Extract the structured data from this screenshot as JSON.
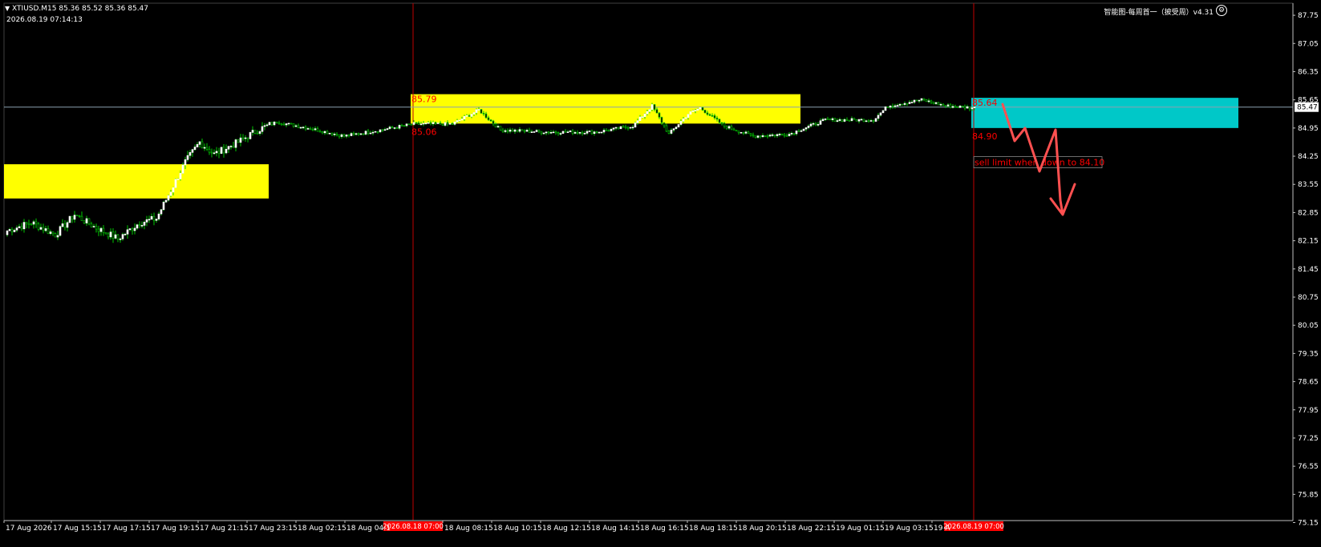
{
  "header": {
    "menu_icon": "triangle-down-icon",
    "symbol_line": "XTIUSD.M15  85.36 85.52 85.36 85.47",
    "timestamp": "2026.08.19 07:14:13",
    "indicator_label": "智能图-每周首一（披受周）v4.31",
    "settings_icon": "gear-circle-icon"
  },
  "colors": {
    "background": "#000000",
    "bull_candle": "#ffffff",
    "bear_candle": "#00c800",
    "wick": "#00c800",
    "zone_yellow": "#ffff00",
    "zone_cyan": "#00c8c8",
    "vline": "#c00000",
    "bid_line": "#8aa0b0",
    "label_red": "#ff0000",
    "arrow": "#ff5050"
  },
  "chart_data": {
    "type": "candlestick",
    "symbol": "XTIUSD",
    "timeframe": "M15",
    "ylim": [
      75.2,
      88.05
    ],
    "price_axis_ticks": [
      "87.75",
      "87.05",
      "86.35",
      "85.65",
      "84.95",
      "84.25",
      "83.55",
      "82.85",
      "82.15",
      "81.45",
      "80.75",
      "80.05",
      "79.35",
      "78.65",
      "77.95",
      "77.25",
      "76.55",
      "75.85",
      "75.15"
    ],
    "current_price": "85.47",
    "time_axis_labels": [
      "17 Aug 2026",
      "17 Aug 15:15",
      "17 Aug 17:15",
      "17 Aug 19:15",
      "17 Aug 21:15",
      "17 Aug 23:15",
      "18 Aug 02:15",
      "18 Aug 04:1",
      "18 Aug 08:15",
      "18 Aug 10:15",
      "18 Aug 12:15",
      "18 Aug 14:15",
      "18 Aug 16:15",
      "18 Aug 18:15",
      "18 Aug 20:15",
      "18 Aug 22:15",
      "19 Aug 01:15",
      "19 Aug 03:15",
      "19 A"
    ],
    "vertical_markers": [
      {
        "label": "2026.08.18 07:00",
        "bar": 169
      },
      {
        "label": "2026.08.19 07:00",
        "bar": 402
      }
    ],
    "zones": [
      {
        "color": "yellow",
        "bar_start": 0,
        "bar_end": 109,
        "high": 84.05,
        "low": 83.2
      },
      {
        "color": "yellow",
        "bar_start": 169,
        "bar_end": 330,
        "high": 85.79,
        "low": 85.06,
        "high_label": "85.79",
        "low_label": "85.06"
      },
      {
        "color": "cyan",
        "bar_start": 402,
        "bar_end": 512,
        "high": 85.7,
        "low": 84.95,
        "high_label": "85.64",
        "low_label": "84.90"
      }
    ],
    "annotation": "sell limit when down to 84.10",
    "anchors": [
      {
        "bar": 0,
        "price": 82.4
      },
      {
        "bar": 10,
        "price": 82.6
      },
      {
        "bar": 20,
        "price": 82.3
      },
      {
        "bar": 28,
        "price": 82.8
      },
      {
        "bar": 36,
        "price": 82.5
      },
      {
        "bar": 46,
        "price": 82.2
      },
      {
        "bar": 55,
        "price": 82.6
      },
      {
        "bar": 62,
        "price": 82.7
      },
      {
        "bar": 68,
        "price": 83.4
      },
      {
        "bar": 74,
        "price": 84.1
      },
      {
        "bar": 80,
        "price": 84.6
      },
      {
        "bar": 86,
        "price": 84.3
      },
      {
        "bar": 96,
        "price": 84.6
      },
      {
        "bar": 104,
        "price": 84.9
      },
      {
        "bar": 112,
        "price": 85.1
      },
      {
        "bar": 125,
        "price": 84.95
      },
      {
        "bar": 140,
        "price": 84.75
      },
      {
        "bar": 155,
        "price": 84.9
      },
      {
        "bar": 169,
        "price": 85.05
      },
      {
        "bar": 185,
        "price": 85.05
      },
      {
        "bar": 196,
        "price": 85.4
      },
      {
        "bar": 205,
        "price": 84.9
      },
      {
        "bar": 225,
        "price": 84.85
      },
      {
        "bar": 245,
        "price": 84.85
      },
      {
        "bar": 260,
        "price": 85.0
      },
      {
        "bar": 268,
        "price": 85.5
      },
      {
        "bar": 275,
        "price": 84.8
      },
      {
        "bar": 283,
        "price": 85.3
      },
      {
        "bar": 288,
        "price": 85.45
      },
      {
        "bar": 298,
        "price": 85.0
      },
      {
        "bar": 310,
        "price": 84.75
      },
      {
        "bar": 325,
        "price": 84.8
      },
      {
        "bar": 340,
        "price": 85.15
      },
      {
        "bar": 360,
        "price": 85.15
      },
      {
        "bar": 366,
        "price": 85.5
      },
      {
        "bar": 380,
        "price": 85.65
      },
      {
        "bar": 390,
        "price": 85.5
      },
      {
        "bar": 402,
        "price": 85.45
      }
    ]
  }
}
